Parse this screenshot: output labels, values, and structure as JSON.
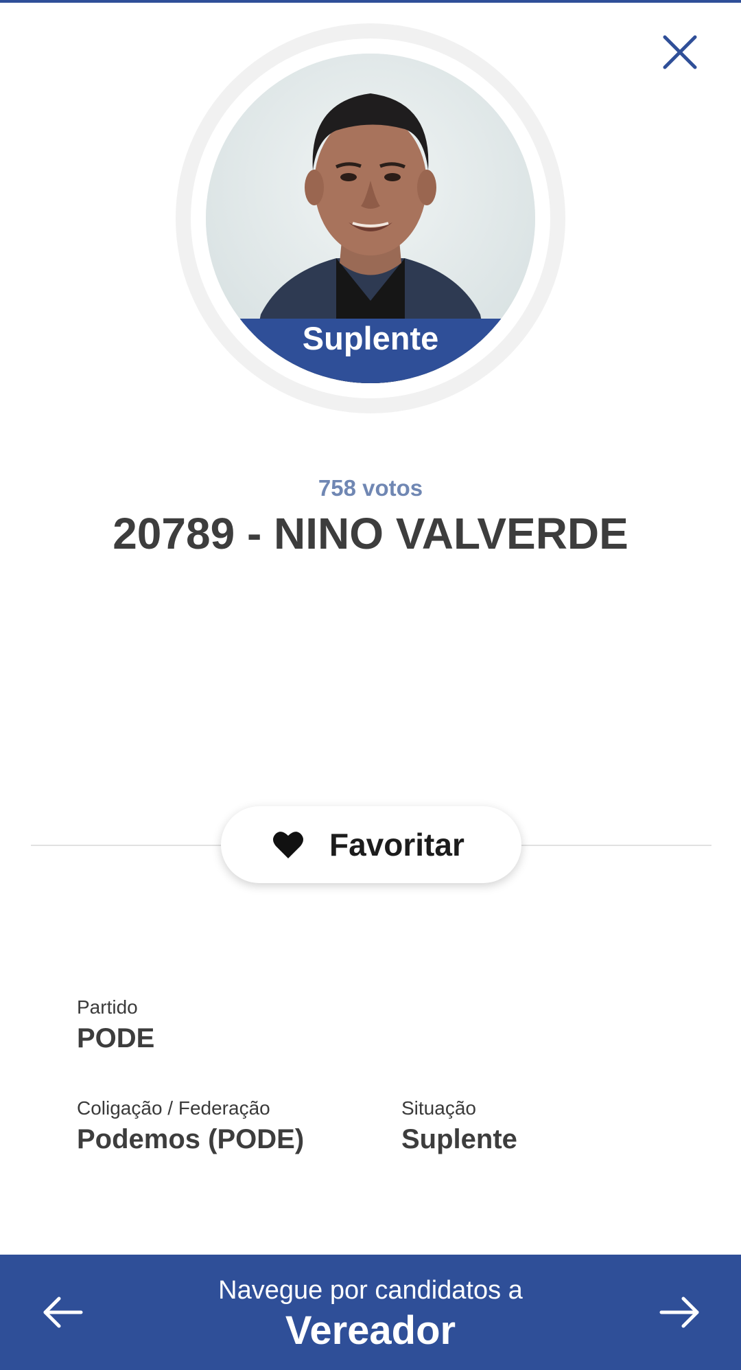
{
  "candidate": {
    "status_badge": "Suplente",
    "votes": "758 votos",
    "title": "20789 - NINO VALVERDE"
  },
  "actions": {
    "favorite_label": "Favoritar"
  },
  "details": {
    "party_label": "Partido",
    "party_value": "PODE",
    "coalition_label": "Coligação / Federação",
    "coalition_value": "Podemos (PODE)",
    "situation_label": "Situação",
    "situation_value": "Suplente"
  },
  "navigation": {
    "caption": "Navegue por candidatos a",
    "office": "Vereador"
  },
  "icons": {
    "close": "close-icon",
    "favorite": "heart-icon",
    "previous": "arrow-left-icon",
    "next": "arrow-right-icon"
  },
  "colors": {
    "brand_blue": "#2f4f98",
    "votes_text": "#7087b3",
    "title_text": "#3d3d3d"
  }
}
